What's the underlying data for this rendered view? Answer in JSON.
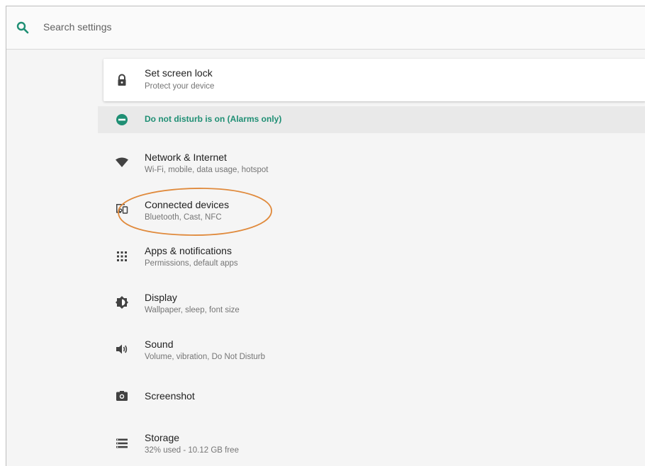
{
  "search": {
    "placeholder": "Search settings"
  },
  "lock_card": {
    "title": "Set screen lock",
    "subtitle": "Protect your device"
  },
  "dnd": {
    "label": "Do not disturb is on (Alarms only)"
  },
  "items": [
    {
      "title": "Network & Internet",
      "subtitle": "Wi-Fi, mobile, data usage, hotspot",
      "icon": "wifi-icon"
    },
    {
      "title": "Connected devices",
      "subtitle": "Bluetooth, Cast, NFC",
      "icon": "devices-icon"
    },
    {
      "title": "Apps & notifications",
      "subtitle": "Permissions, default apps",
      "icon": "apps-grid-icon"
    },
    {
      "title": "Display",
      "subtitle": "Wallpaper, sleep, font size",
      "icon": "brightness-icon"
    },
    {
      "title": "Sound",
      "subtitle": "Volume, vibration, Do Not Disturb",
      "icon": "volume-icon"
    },
    {
      "title": "Screenshot",
      "subtitle": "",
      "icon": "camera-icon"
    },
    {
      "title": "Storage",
      "subtitle": "32% used - 10.12 GB free",
      "icon": "storage-icon"
    }
  ],
  "colors": {
    "accent": "#1f8f74",
    "annotation": "#e08a3c"
  }
}
